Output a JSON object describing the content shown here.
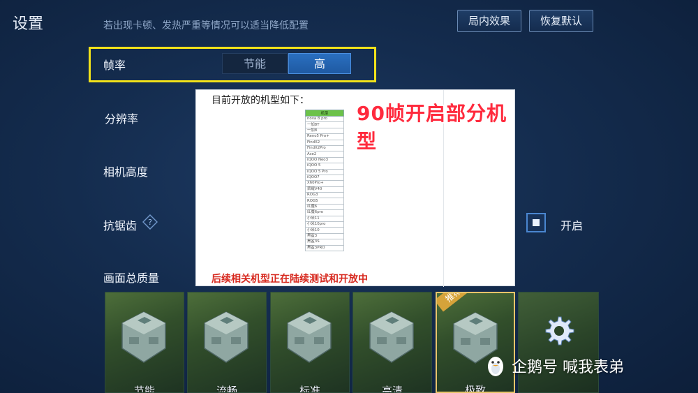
{
  "header": {
    "title": "设置",
    "hint": "若出现卡顿、发热严重等情况可以适当降低配置",
    "btn_effect": "局内效果",
    "btn_reset": "恢复默认"
  },
  "settings": {
    "fps_label": "帧率",
    "fps_options": [
      "节能",
      "高"
    ],
    "fps_selected": "高",
    "resolution_label": "分辨率",
    "camera_label": "相机高度",
    "antialias_label": "抗锯齿",
    "antialias_value": "开启",
    "quality_label": "画面总质量"
  },
  "overlay": {
    "heading": "目前开放的机型如下：",
    "banner": "90帧开启部分机型",
    "table_header": "机型",
    "models": [
      "nova 8 pro",
      "一加8T",
      "一加8",
      "Reno5 Pro+",
      "FindX2",
      "FindX2Pro",
      "Ace2",
      "iQOO Neo3",
      "iQOO 5",
      "iQOO 5 Pro",
      "iQOO7",
      "X60Pro+",
      "荣耀V40",
      "ROG3",
      "ROG5",
      "红魔6",
      "红魔6pro",
      "小米11",
      "小米10pro",
      "小米10",
      "黑鲨3",
      "黑鲨3S",
      "黑鲨3PRO"
    ],
    "caption": "后续相关机型正在陆续测试和开放中"
  },
  "quality_presets": [
    {
      "name": "节能"
    },
    {
      "name": "流畅"
    },
    {
      "name": "标准"
    },
    {
      "name": "高清"
    },
    {
      "name": "极致",
      "badge": "推荐"
    }
  ],
  "watermark": {
    "text": "企鹅号 喊我表弟"
  },
  "colors": {
    "highlight": "#f2e21a",
    "selected_segment": "#2a6fc0",
    "banner": "#ff2a3d",
    "caption": "#d7281e"
  }
}
